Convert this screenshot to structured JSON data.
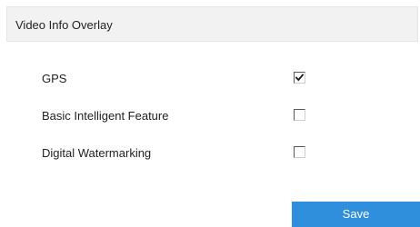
{
  "panel": {
    "title": "Video Info Overlay"
  },
  "options": [
    {
      "label": "GPS",
      "checked": true
    },
    {
      "label": "Basic Intelligent Feature",
      "checked": false
    },
    {
      "label": "Digital Watermarking",
      "checked": false
    }
  ],
  "actions": {
    "save_label": "Save"
  },
  "colors": {
    "header_bg": "#f2f2f2",
    "button_bg": "#2f8fdc",
    "button_text": "#ffffff",
    "text": "#222222"
  }
}
